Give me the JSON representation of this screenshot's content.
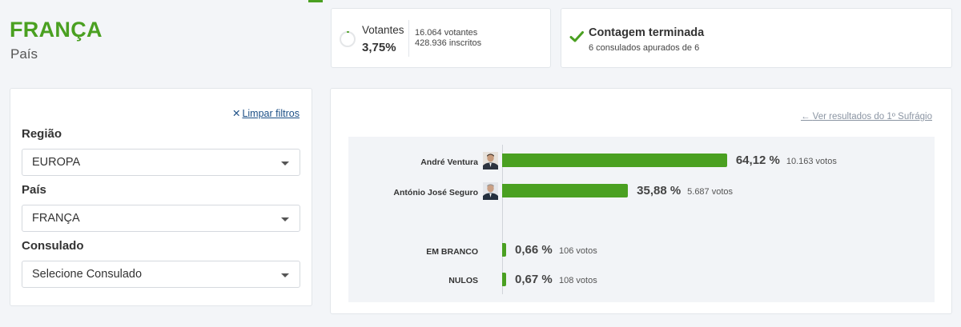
{
  "location": {
    "title": "FRANÇA",
    "subtitle": "País"
  },
  "voters": {
    "label": "Votantes",
    "percentage": "3,75%",
    "percentage_value": 3.75,
    "count": "16.064 votantes",
    "registered": "428.936 inscritos"
  },
  "counting": {
    "title": "Contagem terminada",
    "subtitle": "6 consulados apurados de 6"
  },
  "filters": {
    "clear_label": "Limpar filtros",
    "region_label": "Região",
    "region_value": "EUROPA",
    "country_label": "País",
    "country_value": "FRANÇA",
    "consulate_label": "Consulado",
    "consulate_placeholder": "Selecione Consulado"
  },
  "results": {
    "back_link": "Ver resultados do 1º Sufrágio",
    "candidates": [
      {
        "name": "André Ventura",
        "percent_label": "64,12 %",
        "percent": 64.12,
        "votes": "10.163 votos"
      },
      {
        "name": "António José Seguro",
        "percent_label": "35,88 %",
        "percent": 35.88,
        "votes": "5.687 votos"
      }
    ],
    "others": [
      {
        "name": "EM BRANCO",
        "percent_label": "0,66 %",
        "percent": 0.66,
        "votes": "106 votos"
      },
      {
        "name": "NULOS",
        "percent_label": "0,67 %",
        "percent": 0.67,
        "votes": "108 votos"
      }
    ]
  },
  "colors": {
    "accent": "#4aa021",
    "link": "#1c4f86",
    "muted_link": "#8b95a3"
  }
}
